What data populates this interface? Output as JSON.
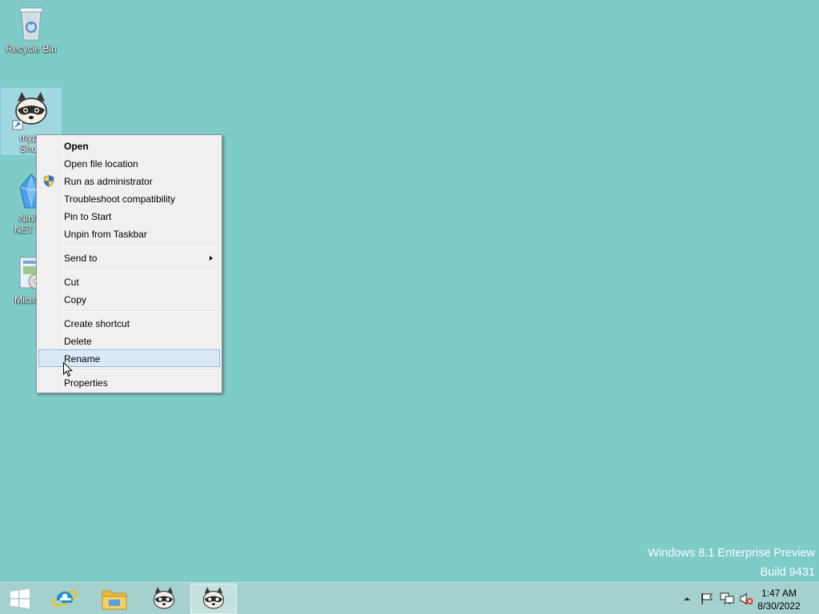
{
  "desktop": {
    "background": "#7ecbc7",
    "icons": [
      {
        "label": "Recycle Bin",
        "icon": "recycle-bin-icon"
      },
      {
        "label": "mypo\nShort",
        "icon": "raccoon-shortcut-icon"
      },
      {
        "label": "Ninite\nNET De",
        "icon": "ninite-icon"
      },
      {
        "label": "Microso",
        "icon": "microsoft-installer-icon"
      }
    ]
  },
  "watermark": {
    "line1": "Windows 8.1 Enterprise Preview",
    "line2": "Build 9431"
  },
  "context_menu": {
    "items": [
      {
        "label": "Open"
      },
      {
        "label": "Open file location"
      },
      {
        "label": "Run as administrator",
        "icon": "uac-shield-icon"
      },
      {
        "label": "Troubleshoot compatibility"
      },
      {
        "label": "Pin to Start"
      },
      {
        "label": "Unpin from Taskbar"
      },
      {
        "label": "Send to"
      },
      {
        "label": "Cut"
      },
      {
        "label": "Copy"
      },
      {
        "label": "Create shortcut"
      },
      {
        "label": "Delete"
      },
      {
        "label": "Rename"
      },
      {
        "label": "Properties"
      }
    ],
    "highlighted": "Rename",
    "highlight_color": "#dbe8f6"
  },
  "taskbar": {
    "buttons": [
      {
        "icon": "windows-start-icon"
      },
      {
        "icon": "internet-explorer-icon"
      },
      {
        "icon": "file-explorer-icon"
      },
      {
        "icon": "raccoon-app-icon"
      },
      {
        "icon": "raccoon-app-icon",
        "active": true
      }
    ],
    "tray_icons": [
      "show-hidden-icons-chevron-icon",
      "action-center-flag-icon",
      "network-icon",
      "volume-muted-icon"
    ],
    "clock": {
      "time": "1:47 AM",
      "date": "8/30/2022"
    }
  }
}
